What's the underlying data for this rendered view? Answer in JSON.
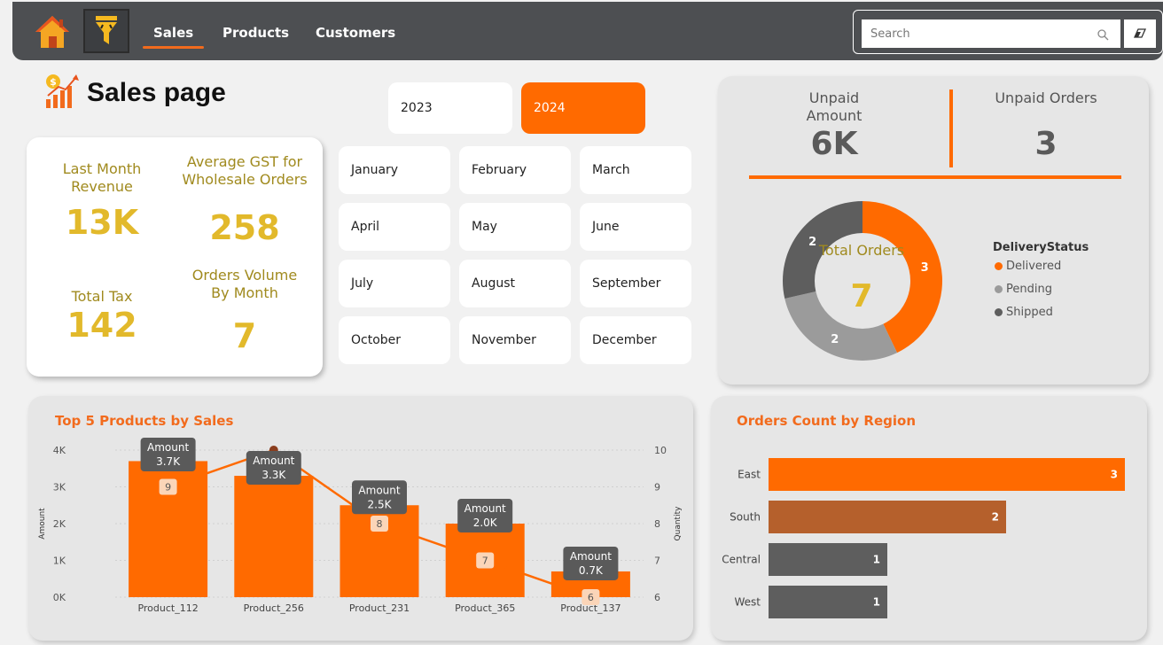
{
  "nav": {
    "tabs": [
      {
        "label": "Sales",
        "active": true
      },
      {
        "label": "Products",
        "active": false
      },
      {
        "label": "Customers",
        "active": false
      }
    ],
    "search_placeholder": "Search"
  },
  "page_title": "Sales page",
  "years": [
    {
      "label": "2023",
      "selected": false
    },
    {
      "label": "2024",
      "selected": true
    }
  ],
  "kpis": {
    "last_month_revenue": {
      "label": "Last Month Revenue",
      "value": "13K"
    },
    "avg_gst": {
      "label": "Average GST for Wholesale Orders",
      "value": "258"
    },
    "total_tax": {
      "label": "Total Tax",
      "value": "142"
    },
    "orders_volume": {
      "label": "Orders Volume By Month",
      "value": "7"
    }
  },
  "months": [
    "January",
    "February",
    "March",
    "April",
    "May",
    "June",
    "July",
    "August",
    "September",
    "October",
    "November",
    "December"
  ],
  "unpaid": {
    "amount_label": "Unpaid Amount",
    "amount_value": "6K",
    "orders_label": "Unpaid Orders",
    "orders_value": "3"
  },
  "donut": {
    "center_label": "Total Orders",
    "center_value": "7",
    "legend_title": "DeliveryStatus"
  },
  "colors": {
    "accent": "#ff6a00",
    "delivered": "#ff6a00",
    "pending": "#9b9b9b",
    "shipped": "#5e5e5e",
    "south": "#b5602c",
    "gold": "#e2b92b"
  },
  "chart_data": [
    {
      "type": "bar",
      "title": "Top 5 Products by Sales",
      "categories": [
        "Product_112",
        "Product_256",
        "Product_231",
        "Product_365",
        "Product_137"
      ],
      "series": [
        {
          "name": "Amount",
          "values": [
            3700,
            3300,
            2500,
            2000,
            700
          ],
          "labels": [
            "3.7K",
            "3.3K",
            "2.5K",
            "2.0K",
            "0.7K"
          ]
        },
        {
          "name": "Quantity",
          "values": [
            9,
            10,
            8,
            7,
            6
          ],
          "labels": [
            "9",
            "",
            "8",
            "7",
            "6"
          ]
        }
      ],
      "ylabel": "Amount",
      "y2label": "Quantity",
      "ylim": [
        0,
        4000
      ],
      "y2lim": [
        6,
        10
      ],
      "yticks": [
        "0K",
        "1K",
        "2K",
        "3K",
        "4K"
      ],
      "y2ticks": [
        "6",
        "7",
        "8",
        "9",
        "10"
      ]
    },
    {
      "type": "bar",
      "orientation": "horizontal",
      "title": "Orders Count by Region",
      "categories": [
        "East",
        "South",
        "Central",
        "West"
      ],
      "values": [
        3,
        2,
        1,
        1
      ]
    },
    {
      "type": "pie",
      "categories": [
        "Delivered",
        "Pending",
        "Shipped"
      ],
      "values": [
        3,
        2,
        2
      ]
    }
  ]
}
